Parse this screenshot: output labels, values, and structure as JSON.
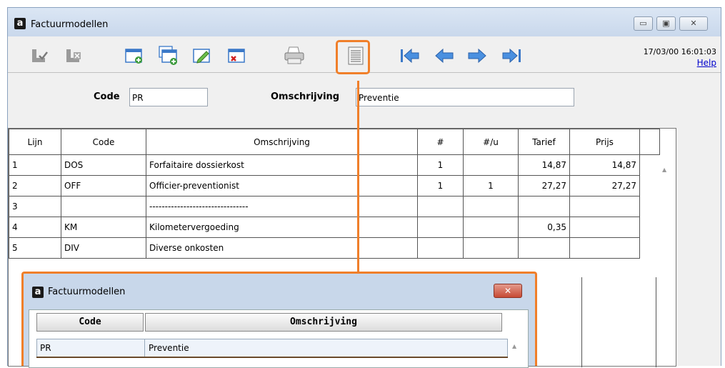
{
  "window": {
    "title": "Factuurmodellen",
    "app_icon_letter": "a",
    "minimize_glyph": "▭",
    "maximize_glyph": "▣",
    "close_glyph": "✕"
  },
  "toolbar": {
    "icons": [
      "save-check-icon",
      "save-cancel-icon",
      "new-icon",
      "copy-new-icon",
      "edit-icon",
      "delete-icon",
      "print-icon",
      "list-icon",
      "first-record-icon",
      "previous-record-icon",
      "next-record-icon",
      "last-record-icon"
    ],
    "datetime": "17/03/00 16:01:03",
    "help_label": "Help"
  },
  "form": {
    "code_label": "Code",
    "code_value": "PR",
    "omschrijving_label": "Omschrijving",
    "omschrijving_value": "Preventie"
  },
  "lines": {
    "headers": [
      "Lijn",
      "Code",
      "Omschrijving",
      "#",
      "#/u",
      "Tarief",
      "Prijs"
    ],
    "rows": [
      {
        "lijn": "1",
        "code": "DOS",
        "omschrijving": "Forfaitaire dossierkost",
        "n": "1",
        "nu": "",
        "tarief": "14,87",
        "prijs": "14,87"
      },
      {
        "lijn": "2",
        "code": "OFF",
        "omschrijving": "Officier-preventionist",
        "n": "1",
        "nu": "1",
        "tarief": "27,27",
        "prijs": "27,27"
      },
      {
        "lijn": "3",
        "code": "",
        "omschrijving": "--------------------------------",
        "n": "",
        "nu": "",
        "tarief": "",
        "prijs": ""
      },
      {
        "lijn": "4",
        "code": "KM",
        "omschrijving": "Kilometervergoeding",
        "n": "",
        "nu": "",
        "tarief": "0,35",
        "prijs": ""
      },
      {
        "lijn": "5",
        "code": "DIV",
        "omschrijving": "Diverse onkosten",
        "n": "",
        "nu": "",
        "tarief": "",
        "prijs": ""
      }
    ]
  },
  "popup": {
    "title": "Factuurmodellen",
    "close_glyph": "✕",
    "headers": [
      "Code",
      "Omschrijving"
    ],
    "rows": [
      {
        "code": "PR",
        "omschrijving": "Preventie"
      }
    ]
  },
  "colors": {
    "highlight": "#f07f2a",
    "title_bar": "#c9d8ec"
  }
}
